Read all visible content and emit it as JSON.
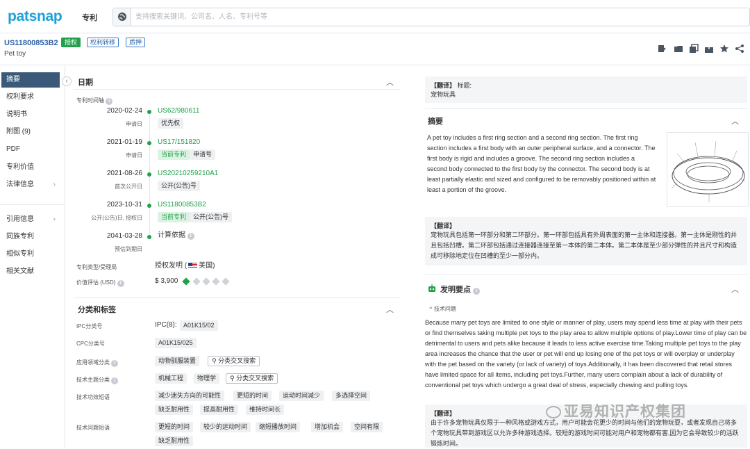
{
  "app": {
    "logo": "patsnap",
    "module": "专利"
  },
  "search": {
    "placeholder": "支持搜索关键词、公司名、人名、专利号等"
  },
  "patent": {
    "number": "US11800853B2",
    "title": "Pet toy",
    "tags": [
      "授权",
      "权利转移",
      "质押"
    ]
  },
  "toolbar": {
    "icons": [
      "edit-icon",
      "folder-icon",
      "copy-icon",
      "export-icon",
      "star-icon",
      "share-icon"
    ]
  },
  "sidebar": {
    "items": [
      {
        "label": "摘要",
        "active": true
      },
      {
        "label": "权利要求"
      },
      {
        "label": "说明书"
      },
      {
        "label": "附图 (9)"
      },
      {
        "label": "PDF"
      },
      {
        "label": "专利价值"
      },
      {
        "label": "法律信息",
        "chevron": "›"
      }
    ],
    "items2": [
      {
        "label": "引用信息",
        "chevron": "›"
      },
      {
        "label": "同族专利"
      },
      {
        "label": "相似专利"
      },
      {
        "label": "相关文献"
      }
    ]
  },
  "dates": {
    "section_title": "日期",
    "timeline_label": "专利时间轴",
    "entries": [
      {
        "date": "2020-02-24",
        "type": "申请日",
        "number": "US62/980611",
        "chips": [
          {
            "text": "优先权",
            "style": "gray"
          }
        ]
      },
      {
        "date": "2021-01-19",
        "type": "申请日",
        "number": "US17/151820",
        "chips": [
          {
            "text": "当前专利",
            "style": "green"
          },
          {
            "text": "申请号",
            "style": "gray"
          }
        ]
      },
      {
        "date": "2021-08-26",
        "type": "首次公开日",
        "number": "US20210259210A1",
        "chips": [
          {
            "text": "公开(公告)号",
            "style": "gray"
          }
        ]
      },
      {
        "date": "2023-10-31",
        "type": "公开(公告)日, 授权日",
        "number": "US11800853B2",
        "chips": [
          {
            "text": "当前专利",
            "style": "green"
          },
          {
            "text": "公开(公告)号",
            "style": "gray"
          }
        ]
      },
      {
        "date": "2041-03-28",
        "type": "预估到期日",
        "number": "计算依据",
        "chips": []
      }
    ],
    "type_label": "专利类型/受理局",
    "type_value": "授权发明 (",
    "country": "美国",
    "value_label": "价值评估 (USD)",
    "value": "$ 3,900"
  },
  "classification": {
    "section_title": "分类和标签",
    "ipc_label": "IPC分类号",
    "ipc_prefix": "IPC(8):",
    "ipc": "A01K15/02",
    "cpc_label": "CPC分类号",
    "cpc": "A01K15/025",
    "app_label": "应用领域分类",
    "app_values": [
      "动物驯服装置"
    ],
    "cross_search": "分类交叉搜索",
    "topic_label": "技术主题分类",
    "topic_values": [
      "机械工程",
      "物理学"
    ],
    "effect_label": "技术功效短语",
    "effect_values": [
      "减少迷失方向的可能性",
      "更短的时间",
      "运动时间减少",
      "多选择空间",
      "缺乏耐用性",
      "提高耐用性",
      "维持时间长"
    ],
    "problem_label": "技术问题短语",
    "problem_values": [
      "更短的时间",
      "较少的运动时间",
      "缩短播放时间",
      "增加机会",
      "空间有限",
      "缺乏耐用性"
    ]
  },
  "translation_title": {
    "label": "【翻译】",
    "key": "标题:",
    "value": "宠物玩具"
  },
  "abstract": {
    "section_title": "摘要",
    "text": "A pet toy includes a first ring section and a second ring section. The first ring section includes a first body with an outer peripheral surface, and a connector. The first body is rigid and includes a groove. The second ring section includes a second body connected to the first body by the connector. The second body is at least partially elastic and sized and configured to be removably positioned within at least a portion of the groove.",
    "translation_label": "【翻译】",
    "translation": "宠物玩具包括第一环部分和第二环部分。第一环部包括具有外周表面的第一主体和连接器。第一主体是刚性的并且包括凹槽。第二环部包括通过连接器连接至第一本体的第二本体。第二本体是至少部分弹性的并且尺寸和构造成可移除地定位在凹槽的至少一部分内。"
  },
  "invention": {
    "section_title": "发明要点",
    "problem_label": "技术问题",
    "text": "Because many pet toys are limited to one style or manner of play, users may spend less time at play with their pets or find themselves taking multiple pet toys to the play area to allow multiple options of play.Lower time of play can be detrimental to users and pets alike because it leads to less active exercise time.Taking multiple pet toys to the play area increases the chance that the user or pet will end up losing one of the pet toys or will overplay or underplay with the pet based on the variety (or lack of variety) of toys.Additionally, it has been discovered that retail stores have limited space for all items, including pet toys.Further, many users complain about a lack of durability of conventional pet toys which undergo a great deal of stress, especially chewing and pulling toys.",
    "translation_label": "【翻译】",
    "translation": "由于许多宠物玩具仅限于一种风格或游戏方式，用户可能会花更少的时间与他们的宠物玩耍，或者发现自己将多个宠物玩具带到游戏区以允许多种游戏选择。较短的游戏时间可能对用户和宠物都有害,因为它会导致较少的活跃锻炼时间。"
  },
  "watermark": "亚易知识产权集团"
}
